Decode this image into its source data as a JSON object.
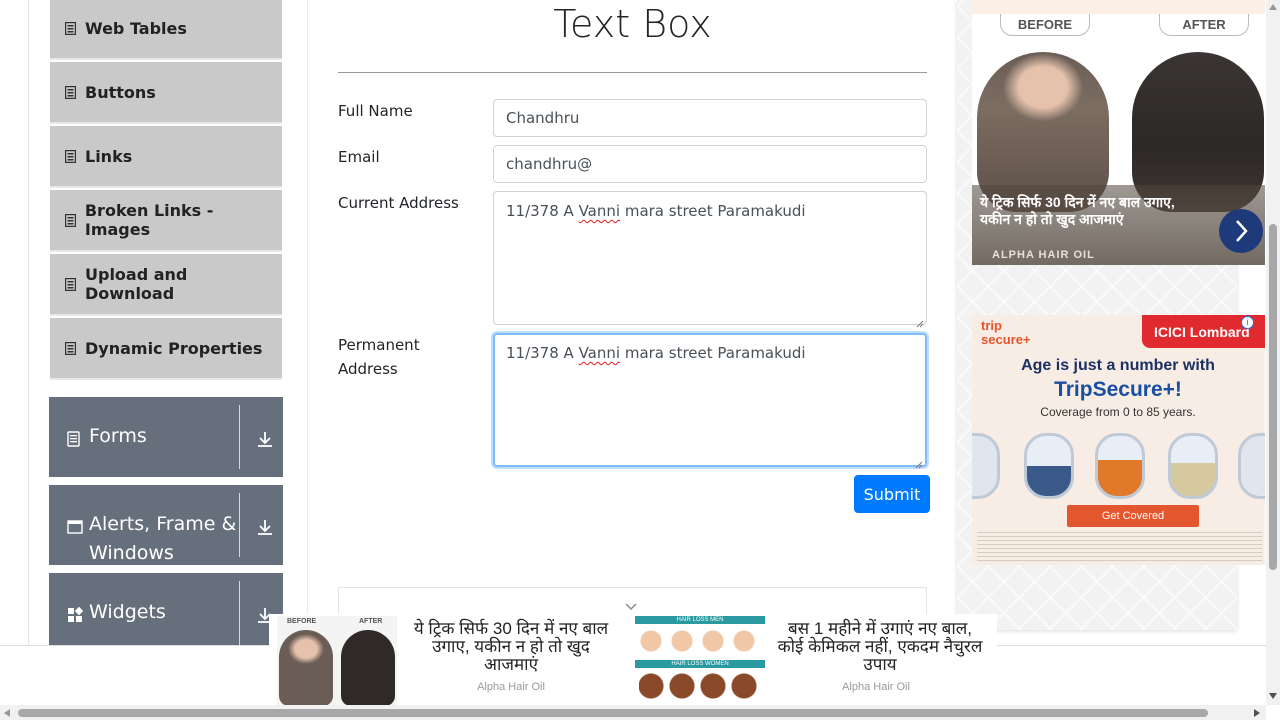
{
  "sidebar": {
    "items": [
      {
        "label": "Web Tables"
      },
      {
        "label": "Buttons"
      },
      {
        "label": "Links"
      },
      {
        "label": "Broken Links - Images"
      },
      {
        "label": "Upload and Download"
      },
      {
        "label": "Dynamic Properties"
      }
    ],
    "groups": [
      {
        "label": "Forms"
      },
      {
        "label_line1": "Alerts, Frame &",
        "label_line2": "Windows"
      },
      {
        "label": "Widgets"
      }
    ]
  },
  "main": {
    "title": "Text Box",
    "full_name_label": "Full Name",
    "full_name_value": "Chandhru",
    "email_label": "Email",
    "email_value": "chandhru@",
    "current_address_label": "Current Address",
    "current_address_prefix": "11/378 A ",
    "current_address_flagged": "Vanni",
    "current_address_suffix": " mara street Paramakudi",
    "permanent_address_label_line1": "Permanent",
    "permanent_address_label_line2": "Address",
    "permanent_address_prefix": "11/378 A ",
    "permanent_address_flagged": "Vanni",
    "permanent_address_suffix": " mara street Paramakudi",
    "submit_label": "Submit"
  },
  "ads": {
    "hair_ad": {
      "before_label": "BEFORE",
      "after_label": "AFTER",
      "headline_line1": "ये ट्रिक सिर्फ 30 दिन में नए बाल उगाए,",
      "headline_line2": "यकीन न हो तो खुद आजमाएं",
      "brand": "ALPHA HAIR OIL"
    },
    "insurance_ad": {
      "trip_brand_line1": "trip",
      "trip_brand_line2": "secure+",
      "insurer": "ICICI Lombard",
      "info_glyph": "i",
      "headline": "Age is just a number with",
      "product": "TripSecure+!",
      "subline": "Coverage from 0 to 85 years.",
      "cta": "Get Covered"
    },
    "bottom_ad": {
      "before_label": "BEFORE",
      "after_label": "AFTER",
      "text1_line1": "ये ट्रिक सिर्फ 30 दिन में नए बाल",
      "text1_line2": "उगाए, यकीन न हो तो खुद",
      "text1_line3": "आजमाएं",
      "source1": "Alpha Hair Oil",
      "men_label": "HAIR LOSS MEN",
      "women_label": "HAIR LOSS WOMEN",
      "text2_line1": "बस 1 महीने में उगाएं नए बाल,",
      "text2_line2": "कोई केमिकल नहीं, एकदम नैचुरल",
      "text2_line3": "उपाय",
      "source2": "Alpha Hair Oil"
    }
  },
  "colors": {
    "primary": "#007bff",
    "sidebar_item_bg": "#c9c9c9",
    "group_bg": "#66707c",
    "focus_border": "#80bdff"
  },
  "icons": {
    "menu_item": "list-icon",
    "forms": "document-icon",
    "alerts": "window-icon",
    "widgets": "grid-icon",
    "expand": "download-arrow-icon",
    "output_toggle": "chevron-down-icon"
  }
}
